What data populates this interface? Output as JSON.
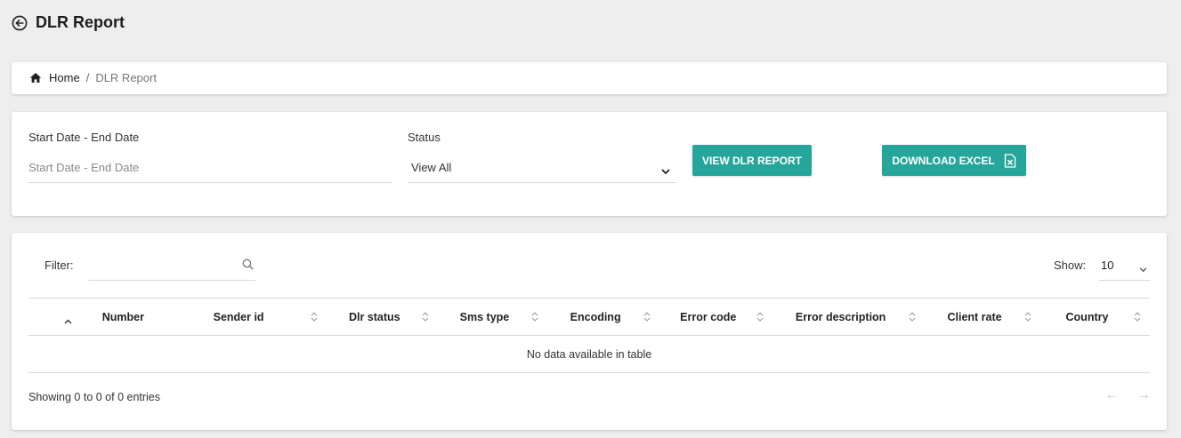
{
  "header": {
    "title": "DLR Report",
    "back_icon": "arrow-circle-left-icon"
  },
  "breadcrumb": {
    "home": "Home",
    "separator": "/",
    "current": "DLR Report"
  },
  "form": {
    "date_label": "Start Date - End Date",
    "date_placeholder": "Start Date - End Date",
    "status_label": "Status",
    "status_value": "View All",
    "view_button": "VIEW DLR REPORT",
    "download_button": "DOWNLOAD EXCEL",
    "accent_color": "#26a69a"
  },
  "table_card": {
    "filter_label": "Filter:",
    "show_label": "Show:",
    "show_value": "10",
    "columns": [
      "Number",
      "Sender id",
      "Dlr status",
      "Sms type",
      "Encoding",
      "Error code",
      "Error description",
      "Client rate",
      "Country"
    ],
    "empty_message": "No data available in table",
    "info": "Showing 0 to 0 of 0 entries",
    "prev": "←",
    "next": "→"
  }
}
